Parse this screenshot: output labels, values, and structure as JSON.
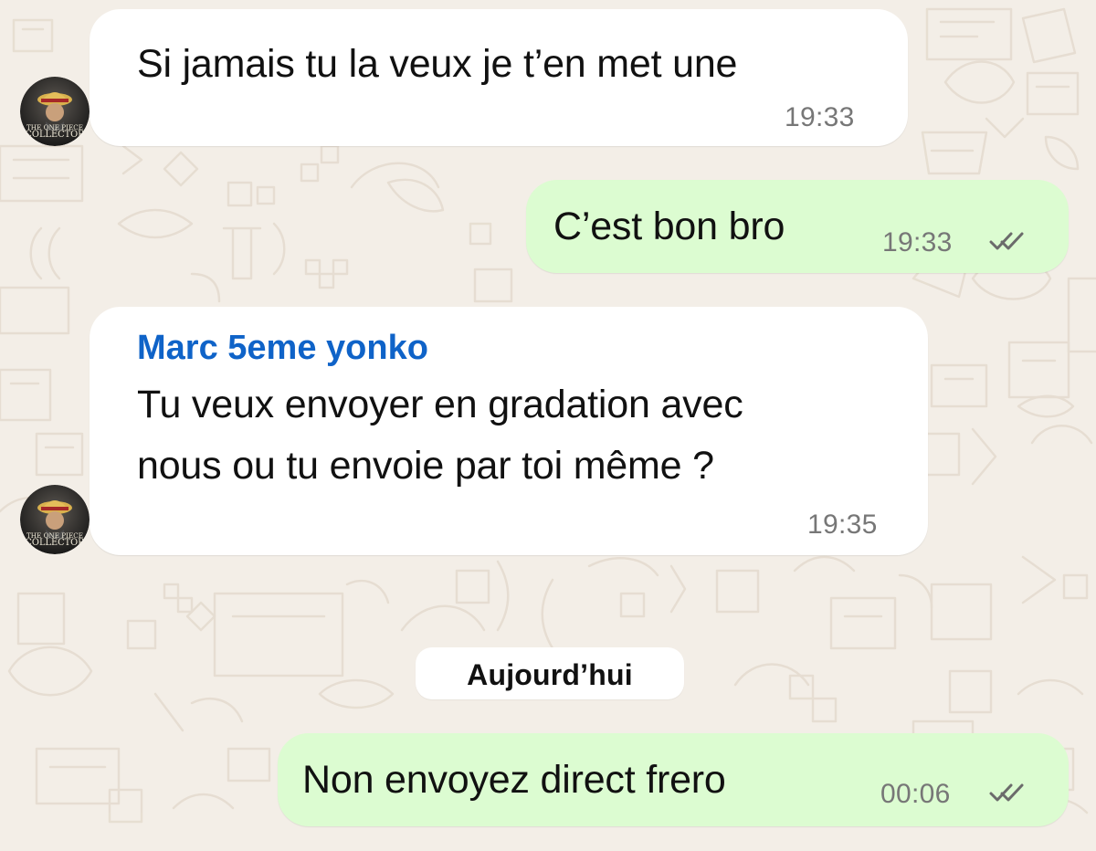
{
  "chat": {
    "messages": [
      {
        "direction": "incoming",
        "text": "Si jamais tu la veux je t’en met une",
        "time": "19:33",
        "avatar_icon": "profile-avatar-icon",
        "avatar_label_top": "THE ONE PIECE",
        "avatar_label_bottom": "COLLECTOR"
      },
      {
        "direction": "outgoing",
        "text": "C’est bon bro",
        "time": "19:33",
        "status_icon": "double-check-icon"
      },
      {
        "direction": "incoming",
        "sender": "Marc 5eme yonko",
        "lines": [
          "Tu veux envoyer en gradation avec",
          "nous ou tu envoie par toi même ?"
        ],
        "time": "19:35",
        "avatar_icon": "profile-avatar-icon",
        "avatar_label_top": "THE ONE PIECE",
        "avatar_label_bottom": "COLLECTOR"
      },
      {
        "direction": "outgoing",
        "text": "Non envoyez direct frero",
        "time": "00:06",
        "status_icon": "double-check-icon"
      }
    ],
    "date_separator": "Aujourd’hui"
  },
  "colors": {
    "background": "#f3eee7",
    "incoming_bubble": "#ffffff",
    "outgoing_bubble": "#dcfcd1",
    "sender_name": "#0f63c8",
    "timestamp": "#777777",
    "read_tick": "#6b6b6b"
  }
}
